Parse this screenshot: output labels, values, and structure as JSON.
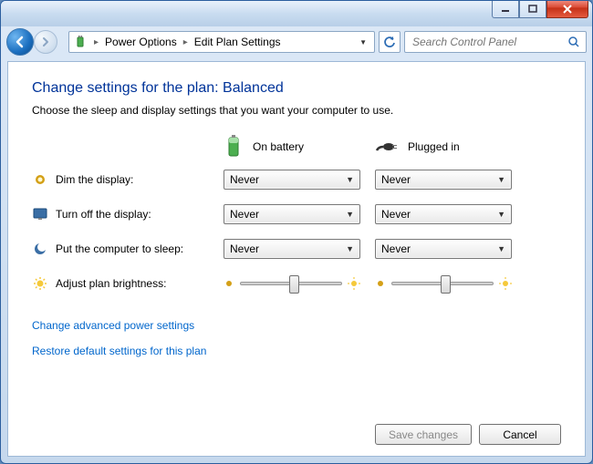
{
  "breadcrumb": {
    "items": [
      "Power Options",
      "Edit Plan Settings"
    ]
  },
  "search": {
    "placeholder": "Search Control Panel"
  },
  "page": {
    "title": "Change settings for the plan: Balanced",
    "description": "Choose the sleep and display settings that you want your computer to use."
  },
  "columns": {
    "battery": "On battery",
    "plugged": "Plugged in"
  },
  "rows": {
    "dim": {
      "label": "Dim the display:",
      "battery": "Never",
      "plugged": "Never"
    },
    "turnoff": {
      "label": "Turn off the display:",
      "battery": "Never",
      "plugged": "Never"
    },
    "sleep": {
      "label": "Put the computer to sleep:",
      "battery": "Never",
      "plugged": "Never"
    },
    "brightness": {
      "label": "Adjust plan brightness:",
      "battery_pct": 50,
      "plugged_pct": 50
    }
  },
  "links": {
    "advanced": "Change advanced power settings",
    "restore": "Restore default settings for this plan"
  },
  "buttons": {
    "save": "Save changes",
    "cancel": "Cancel"
  }
}
